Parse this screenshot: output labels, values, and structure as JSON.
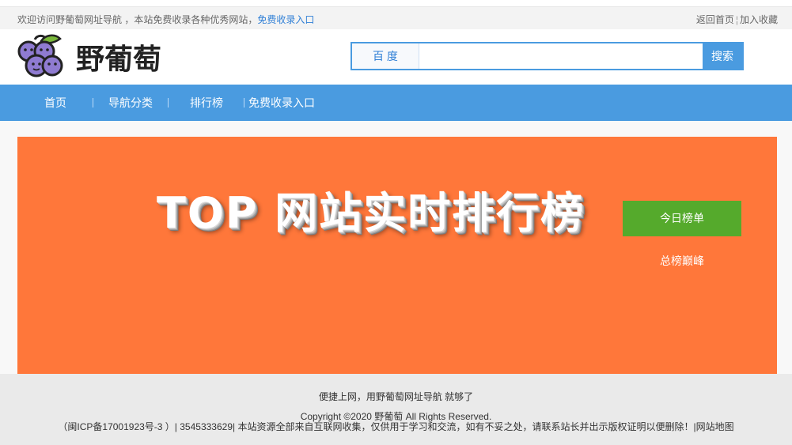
{
  "topbar": {
    "welcome": "欢迎访问野葡萄网址导航 ，本站免费收录各种优秀网站，",
    "submit_link": "免费收录入口",
    "home": "返回首页",
    "sep": "¦",
    "favorite": "加入收藏"
  },
  "header": {
    "logo_text": "野葡萄",
    "search": {
      "engine": "百 度",
      "placeholder": "",
      "button": "搜索"
    }
  },
  "nav": {
    "items": [
      {
        "label": "首页"
      },
      {
        "label": "导航分类"
      },
      {
        "label": "排行榜"
      },
      {
        "label": "免费收录入口"
      }
    ]
  },
  "banner": {
    "title": "TOP 网站实时排行榜",
    "tabs": [
      "今日榜单",
      "总榜巅峰"
    ]
  },
  "footer": {
    "line1": "便捷上网，用野葡萄网址导航 就够了",
    "line2": "Copyright ©2020 野葡萄 All Rights Reserved.",
    "line3": "（闽ICP备17001923号-3 ）| 3545333629| 本站资源全部来自互联网收集，仅供用于学习和交流，如有不妥之处，请联系站长并出示版权证明以便删除！|网站地图"
  },
  "colors": {
    "nav": "#4a9be0",
    "banner": "#ff773a",
    "active_tab": "#55aa2c",
    "grape": "#8f7bd1"
  }
}
